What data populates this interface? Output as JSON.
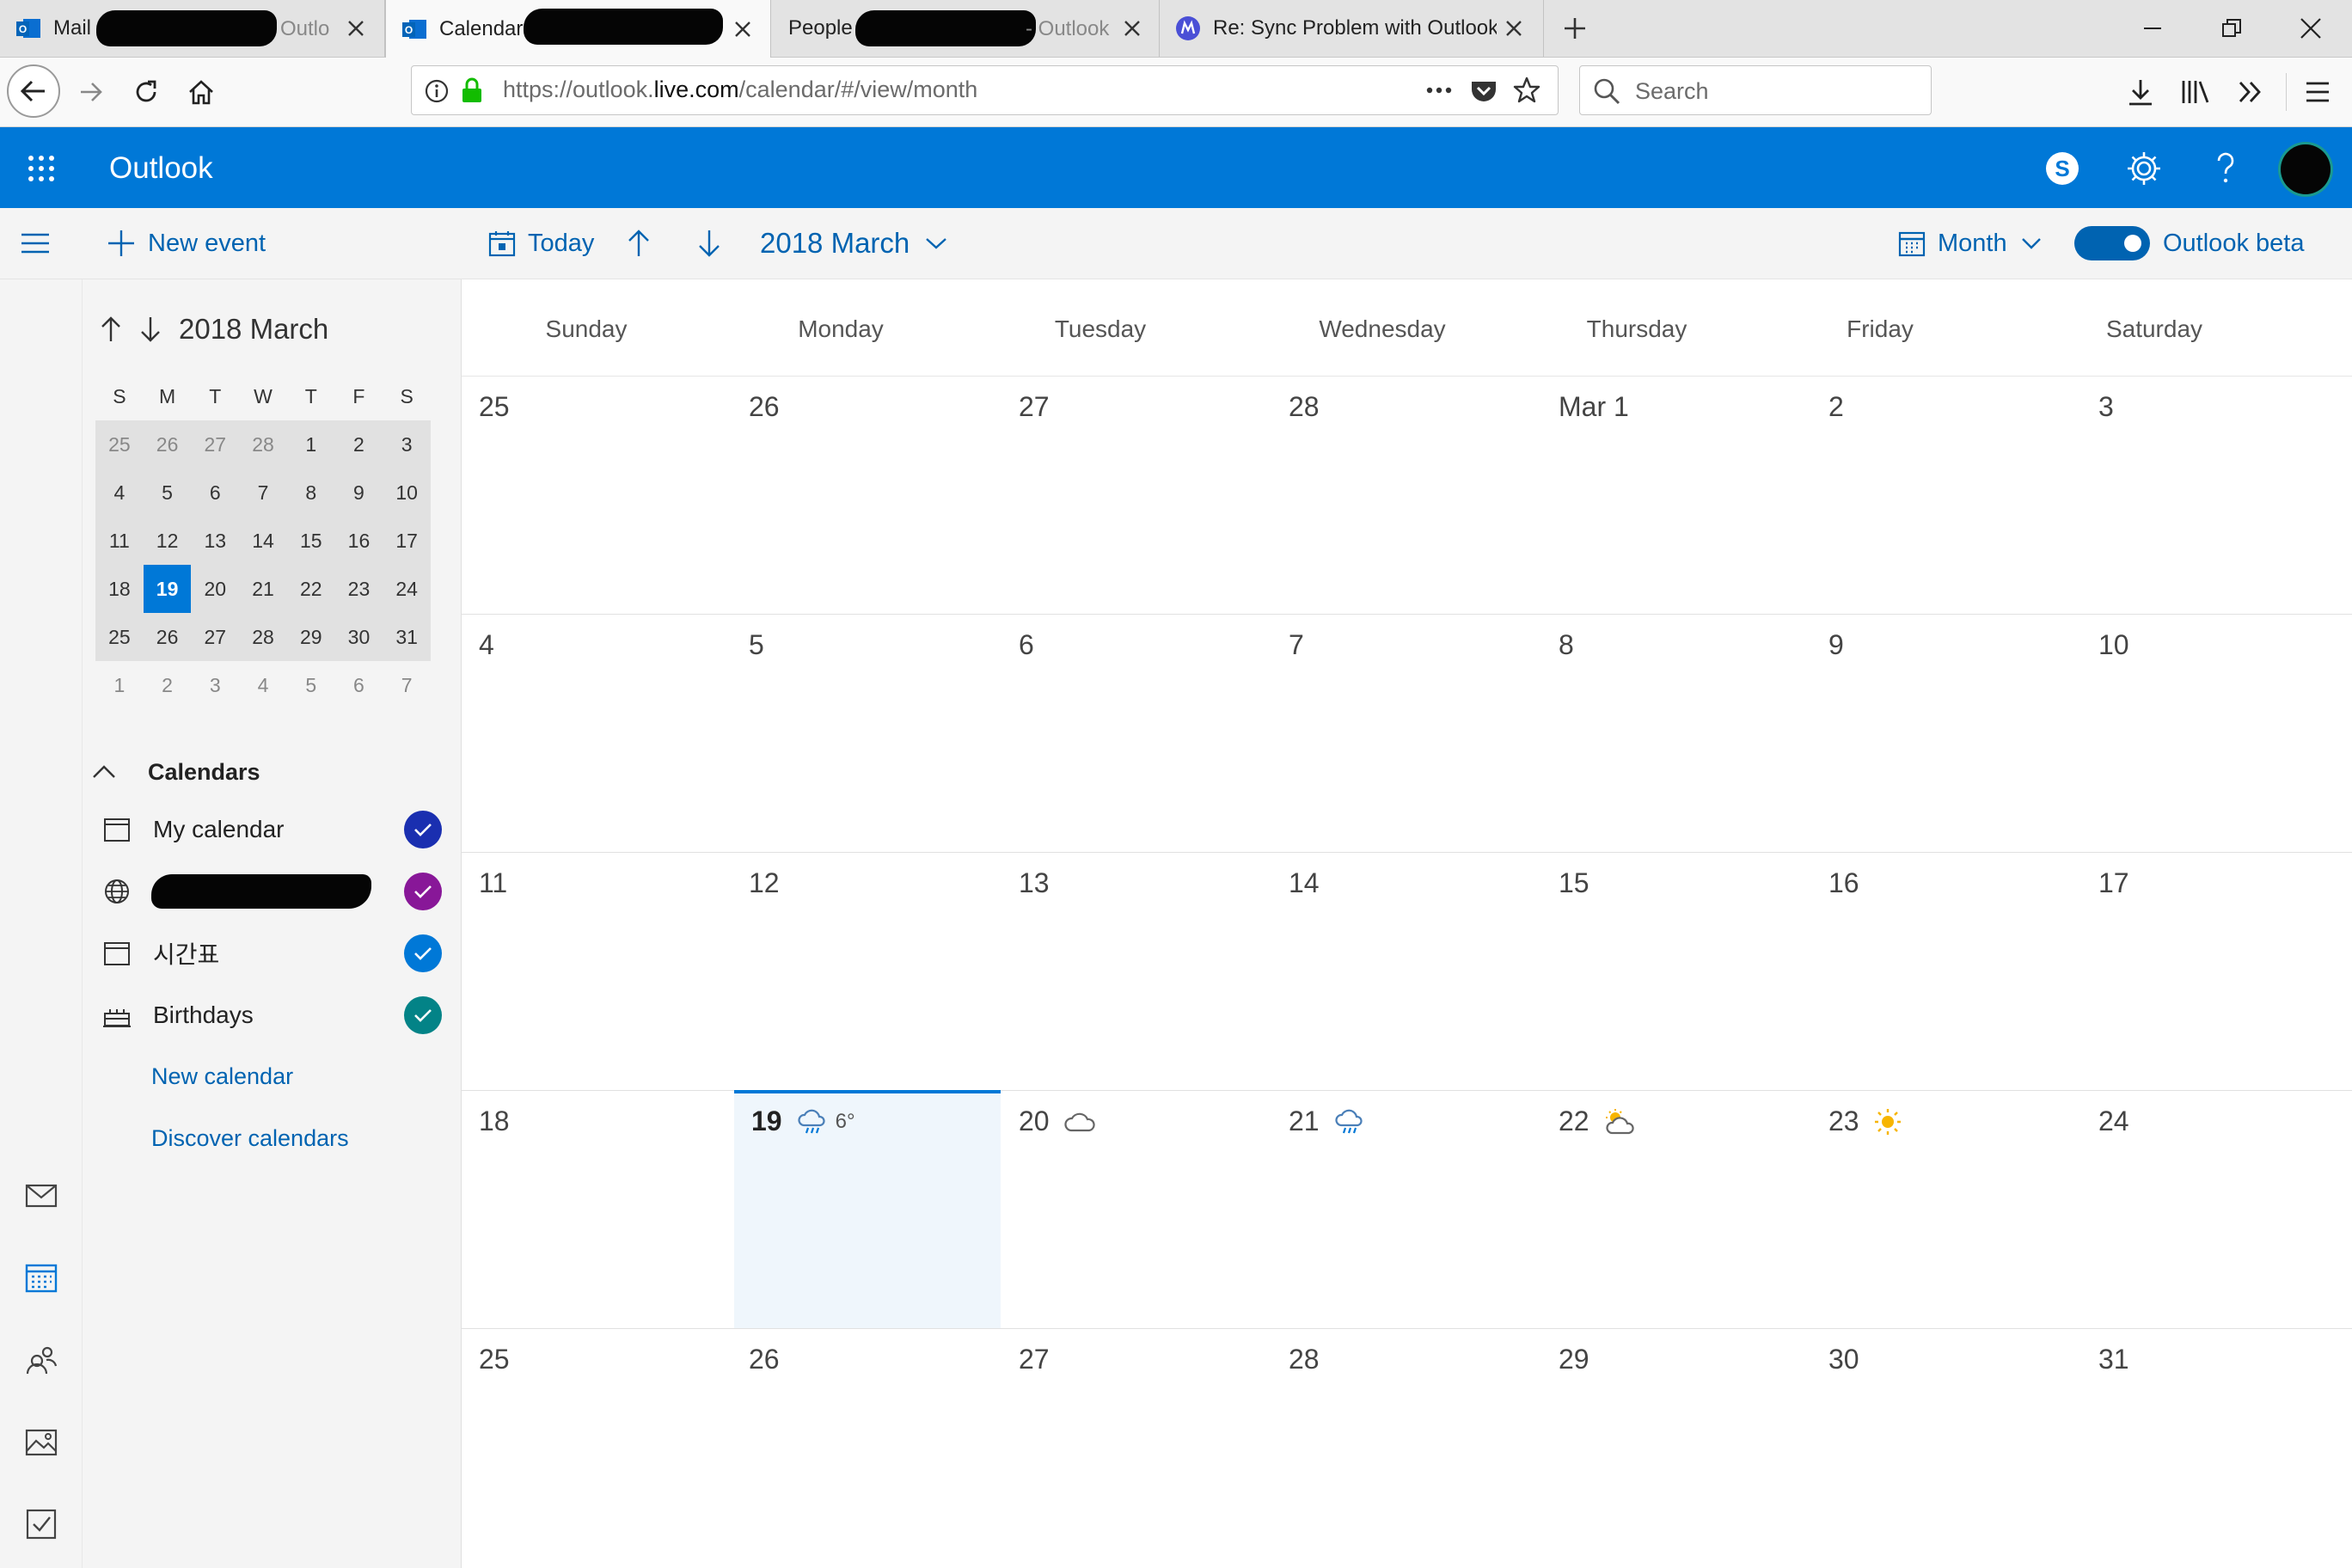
{
  "browser": {
    "tabs": [
      {
        "title": "Mail",
        "suffix": "Outlo",
        "favicon": "outlook-icon",
        "active": false
      },
      {
        "title": "Calendar",
        "suffix": "",
        "favicon": "outlook-icon",
        "active": true
      },
      {
        "title": "People",
        "suffix": "- Outlook",
        "favicon": "",
        "active": false
      },
      {
        "title": "Re: Sync Problem with Outlook",
        "suffix": "",
        "favicon": "mozilla-support-icon",
        "active": false
      }
    ],
    "url": {
      "prefix": "https://outlook.",
      "domain": "live.com",
      "path": "/calendar/#/view/month"
    },
    "search_placeholder": "Search"
  },
  "outlook": {
    "app_name": "Outlook",
    "accent": "#0078d7",
    "command_bar": {
      "new_event": "New event",
      "today": "Today",
      "period": "2018 March",
      "view": "Month",
      "beta_label": "Outlook beta"
    }
  },
  "mini_calendar": {
    "title": "2018 March",
    "weekday_initials": [
      "S",
      "M",
      "T",
      "W",
      "T",
      "F",
      "S"
    ],
    "weeks": [
      [
        "25",
        "26",
        "27",
        "28",
        "1",
        "2",
        "3"
      ],
      [
        "4",
        "5",
        "6",
        "7",
        "8",
        "9",
        "10"
      ],
      [
        "11",
        "12",
        "13",
        "14",
        "15",
        "16",
        "17"
      ],
      [
        "18",
        "19",
        "20",
        "21",
        "22",
        "23",
        "24"
      ],
      [
        "25",
        "26",
        "27",
        "28",
        "29",
        "30",
        "31"
      ],
      [
        "1",
        "2",
        "3",
        "4",
        "5",
        "6",
        "7"
      ]
    ],
    "today": "19"
  },
  "calendars": {
    "heading": "Calendars",
    "items": [
      {
        "name": "My calendar",
        "color": "#1a2fb0",
        "icon": "calendar-icon"
      },
      {
        "name": "",
        "color": "#881798",
        "icon": "globe-icon"
      },
      {
        "name": "시간표",
        "color": "#0078d7",
        "icon": "calendar-icon"
      },
      {
        "name": "Birthdays",
        "color": "#038387",
        "icon": "cake-icon"
      }
    ],
    "new_calendar": "New calendar",
    "discover_calendars": "Discover calendars"
  },
  "month_view": {
    "weekdays": [
      "Sunday",
      "Monday",
      "Tuesday",
      "Wednesday",
      "Thursday",
      "Friday",
      "Saturday"
    ],
    "weeks": [
      [
        "25",
        "26",
        "27",
        "28",
        "Mar 1",
        "2",
        "3"
      ],
      [
        "4",
        "5",
        "6",
        "7",
        "8",
        "9",
        "10"
      ],
      [
        "11",
        "12",
        "13",
        "14",
        "15",
        "16",
        "17"
      ],
      [
        "18",
        "19",
        "20",
        "21",
        "22",
        "23",
        "24"
      ],
      [
        "25",
        "26",
        "27",
        "28",
        "29",
        "30",
        "31"
      ]
    ],
    "today": "19",
    "weather": {
      "19": {
        "icon": "rain-cloud-icon",
        "temp": "6°"
      },
      "20": {
        "icon": "cloud-icon",
        "temp": ""
      },
      "21": {
        "icon": "rain-cloud-icon",
        "temp": ""
      },
      "22": {
        "icon": "partly-sunny-icon",
        "temp": ""
      },
      "23": {
        "icon": "sun-icon",
        "temp": ""
      }
    }
  }
}
